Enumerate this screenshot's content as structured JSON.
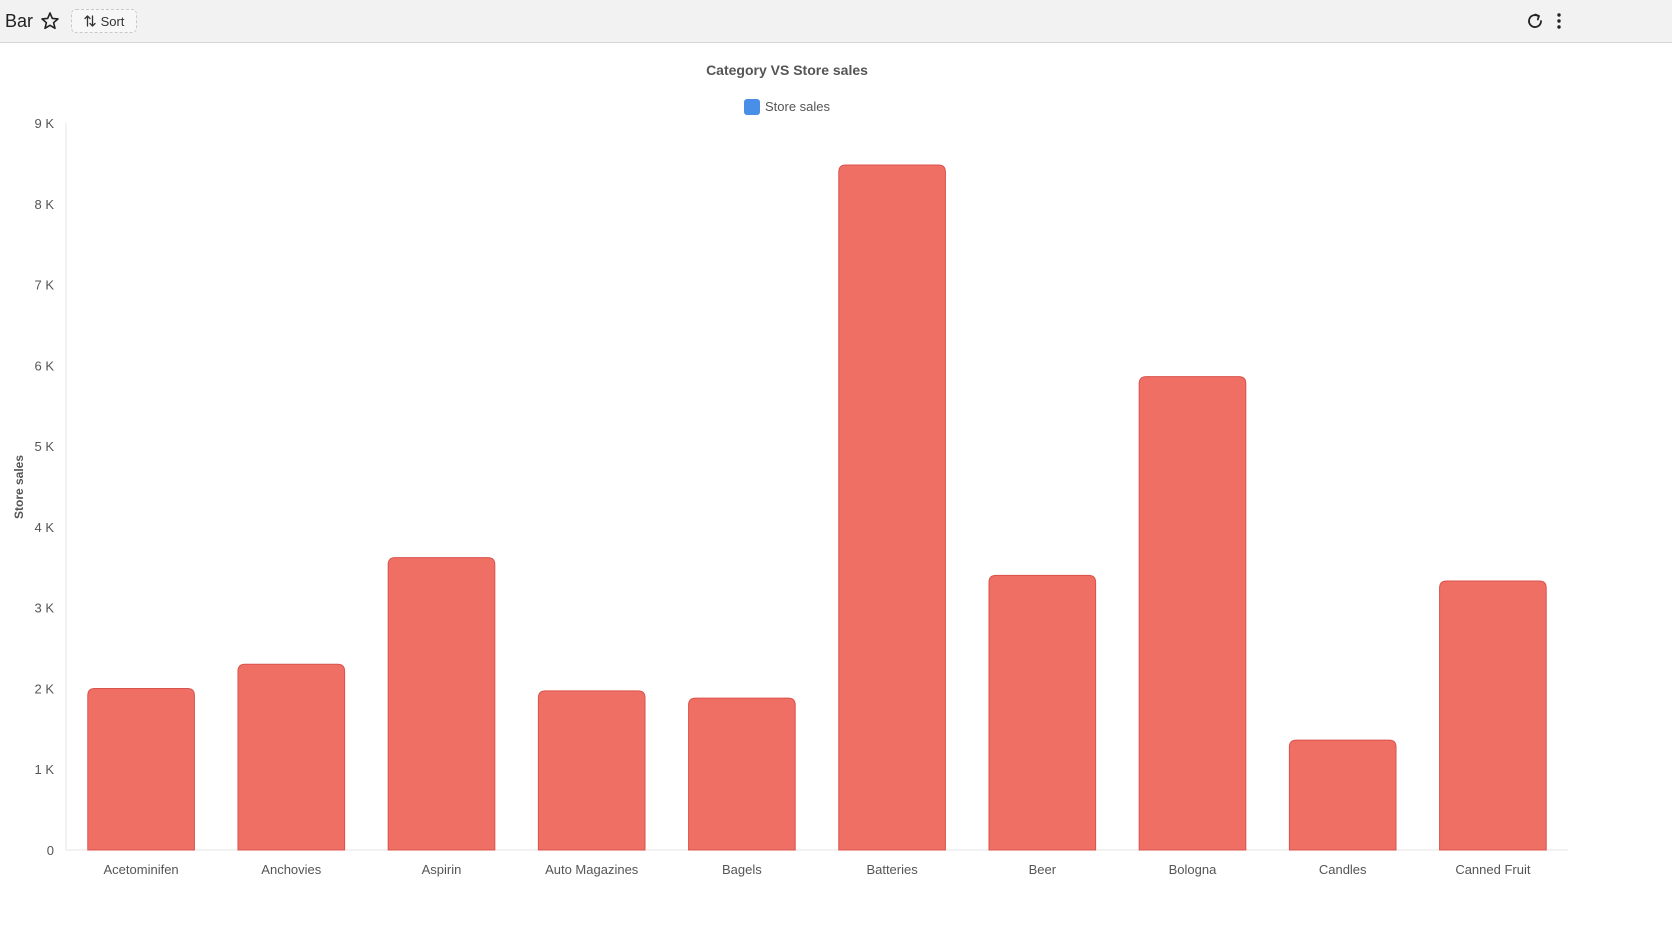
{
  "header": {
    "title": "Bar",
    "sort_label": "Sort",
    "icons": [
      "star-icon",
      "sort-icon",
      "refresh-icon",
      "more-vertical-icon"
    ]
  },
  "colors": {
    "bar_fill": "#EF6F65",
    "bar_stroke": "#D9534C",
    "legend_swatch": "#4A8FE7",
    "header_bg": "#F2F2F2"
  },
  "chart_data": {
    "type": "bar",
    "title": "Category VS Store sales",
    "xlabel": "",
    "ylabel": "Store sales",
    "legend": {
      "position": "top-center",
      "entries": [
        "Store sales"
      ]
    },
    "categories": [
      "Acetominifen",
      "Anchovies",
      "Aspirin",
      "Auto Magazines",
      "Bagels",
      "Batteries",
      "Beer",
      "Bologna",
      "Candles",
      "Canned Fruit"
    ],
    "series": [
      {
        "name": "Store sales",
        "values": [
          2000,
          2300,
          3620,
          1970,
          1880,
          8480,
          3400,
          5860,
          1360,
          3330
        ]
      }
    ],
    "ylim": [
      0,
      9000
    ],
    "yticks": [
      0,
      1000,
      2000,
      3000,
      4000,
      5000,
      6000,
      7000,
      8000,
      9000
    ],
    "ytick_labels": [
      "0",
      "1 K",
      "2 K",
      "3 K",
      "4 K",
      "5 K",
      "6 K",
      "7 K",
      "8 K",
      "9 K"
    ],
    "grid": false
  }
}
